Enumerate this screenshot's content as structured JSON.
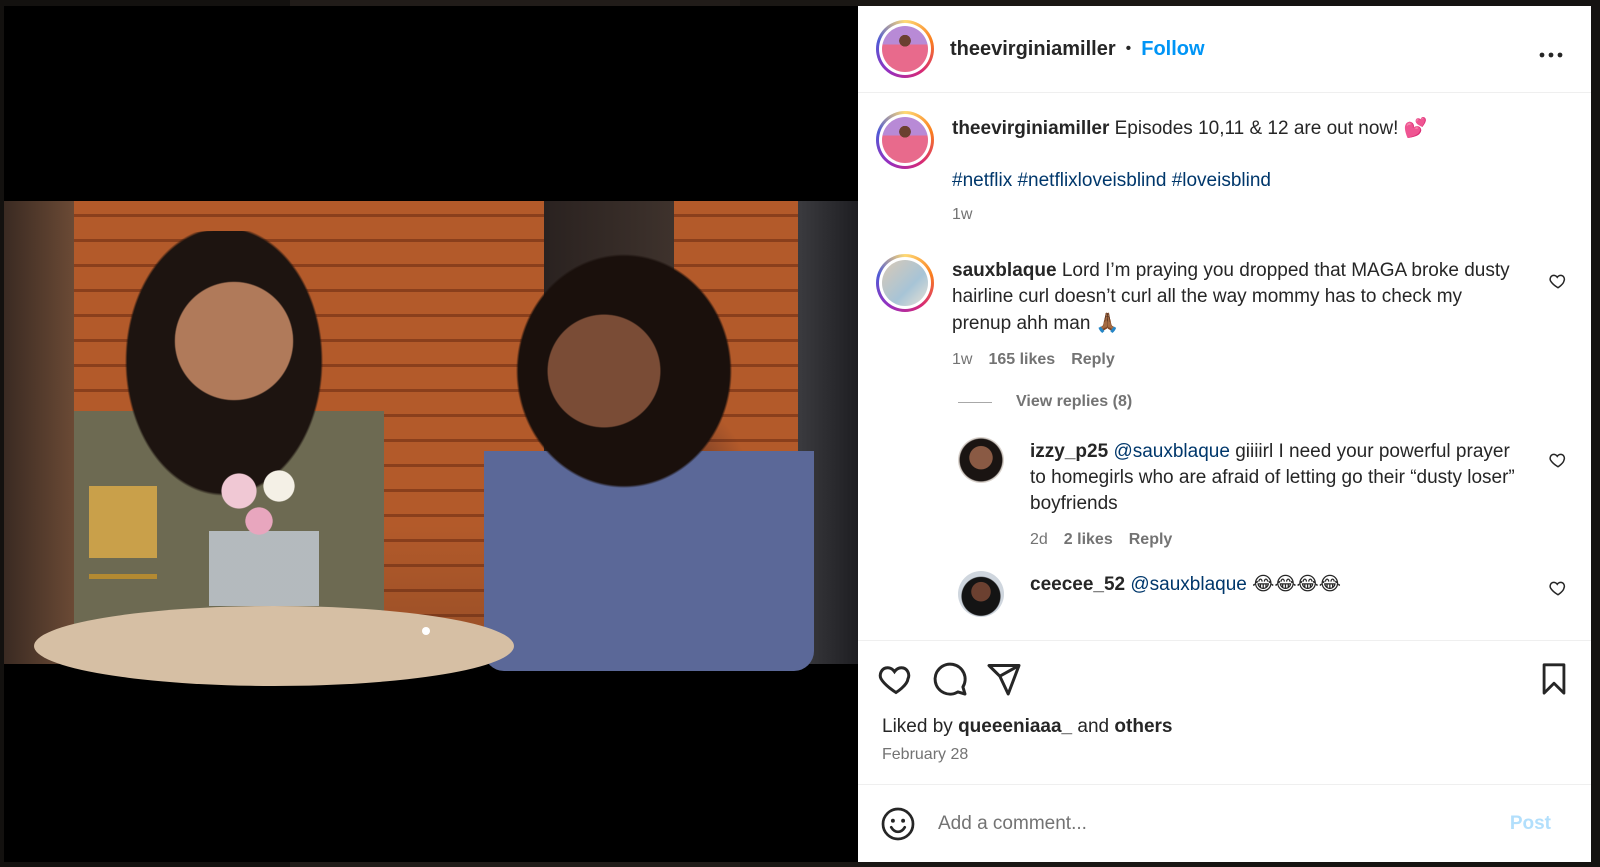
{
  "header": {
    "username": "theevirginiamiller",
    "separator": "•",
    "follow_label": "Follow",
    "more_label": "..."
  },
  "caption": {
    "username": "theevirginiamiller",
    "text": "Episodes 10,11 & 12 are out now!",
    "emoji": "💕",
    "hashtags": [
      "#netflix",
      "#netflixloveisblind",
      "#loveisblind"
    ],
    "age": "1w"
  },
  "comments": [
    {
      "username": "sauxblaque",
      "text": "Lord I’m praying you dropped that MAGA broke dusty hairline curl doesn’t curl all the way mommy has to check my prenup ahh man",
      "emoji": "🙏🏾",
      "age": "1w",
      "likes": "165 likes",
      "reply_label": "Reply",
      "view_replies": "View replies (8)"
    }
  ],
  "replies": [
    {
      "username": "izzy_p25",
      "mention": "@sauxblaque",
      "text": "giiiirl I need your powerful prayer to homegirls who are afraid of letting go their “dusty loser” boyfriends",
      "age": "2d",
      "likes": "2 likes",
      "reply_label": "Reply"
    },
    {
      "username": "ceecee_52",
      "mention": "@sauxblaque",
      "text": "😂😂😂😂"
    }
  ],
  "actions": {
    "like_icon": "heart-icon",
    "comment_icon": "comment-icon",
    "share_icon": "paper-plane-icon",
    "save_icon": "bookmark-icon"
  },
  "likes_line": {
    "prefix": "Liked by",
    "user": "queeeniaaa_",
    "and": "and",
    "others": "others"
  },
  "date": "February 28",
  "add_comment": {
    "placeholder": "Add a comment...",
    "post_label": "Post"
  },
  "colors": {
    "link_blue": "#0095f6",
    "hashtag": "#00376b",
    "muted": "#737373",
    "post_disabled": "#b2dffc"
  }
}
